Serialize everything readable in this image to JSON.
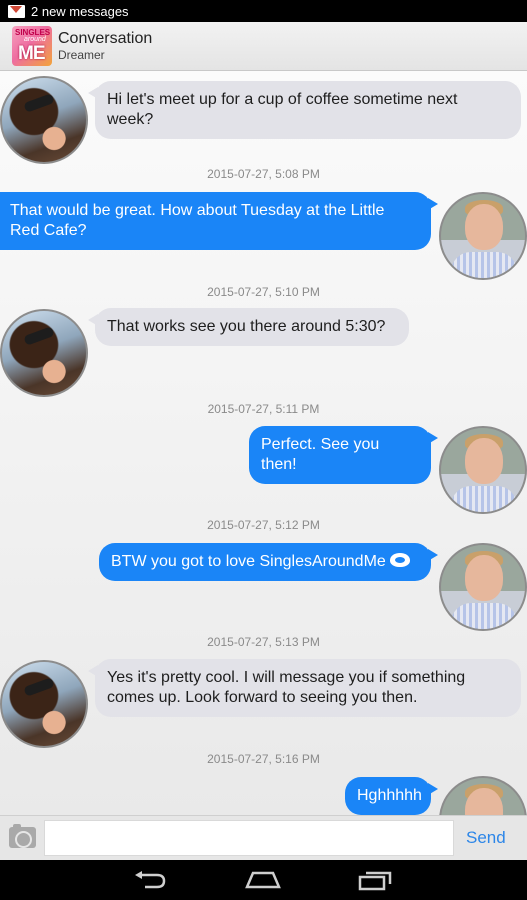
{
  "status_bar": {
    "notification": "2 new messages",
    "icon": "gmail-icon"
  },
  "header": {
    "app_logo_lines": [
      "SINGLES",
      "around",
      "ME"
    ],
    "title": "Conversation",
    "subtitle": "Dreamer"
  },
  "messages": [
    {
      "side": "received",
      "text_line1": "Hi let's meet up for a cup of coffee sometime next",
      "text_line2": "week?",
      "time": "2015-07-27, 5:08 PM"
    },
    {
      "side": "sent",
      "text_line1": "That would be great. How about Tuesday at the Little",
      "text_line2": "Red Cafe?",
      "time": "2015-07-27, 5:10 PM"
    },
    {
      "side": "received",
      "text_line1": "That works see you there around 5:30?",
      "time": "2015-07-27, 5:11 PM"
    },
    {
      "side": "sent",
      "text_line1": "Perfect. See you then!",
      "time": "2015-07-27, 5:12 PM"
    },
    {
      "side": "sent",
      "text_line1": "BTW you got to love SinglesAroundMe",
      "emoji": "emoji-icon",
      "time": "2015-07-27, 5:13 PM"
    },
    {
      "side": "received",
      "text_line1": "Yes it's pretty cool. I will message you if something",
      "text_line2": "comes up. Look forward to seeing you then.",
      "time": "2015-07-27, 5:16 PM"
    },
    {
      "side": "sent",
      "text_line1": "Hghhhhh"
    }
  ],
  "input": {
    "placeholder": "",
    "value": "",
    "send_label": "Send",
    "camera_icon": "camera-icon"
  },
  "nav": {
    "back_icon": "back-icon",
    "home_icon": "home-icon",
    "recent_icon": "recent-apps-icon"
  },
  "colors": {
    "sent_bubble": "#1a85f7",
    "received_bubble": "#e2e2e8",
    "send_text": "#2c86e8"
  }
}
